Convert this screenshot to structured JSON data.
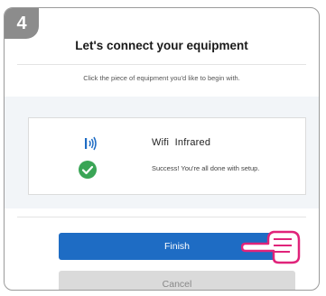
{
  "step": {
    "number": "4"
  },
  "header": {
    "title": "Let's connect your equipment",
    "subtitle": "Click the piece of equipment you'd like to begin with."
  },
  "equipment": {
    "name": "Wifi  Infrared",
    "icon": "wifi-signal-icon",
    "status_icon": "check-circle-icon",
    "status_text": "Success! You're all done with setup."
  },
  "actions": {
    "finish_label": "Finish",
    "cancel_label": "Cancel"
  },
  "colors": {
    "accent": "#1e6cc4",
    "success": "#3aa556",
    "badge": "#8c8c8c",
    "hand": "#e0237a"
  }
}
